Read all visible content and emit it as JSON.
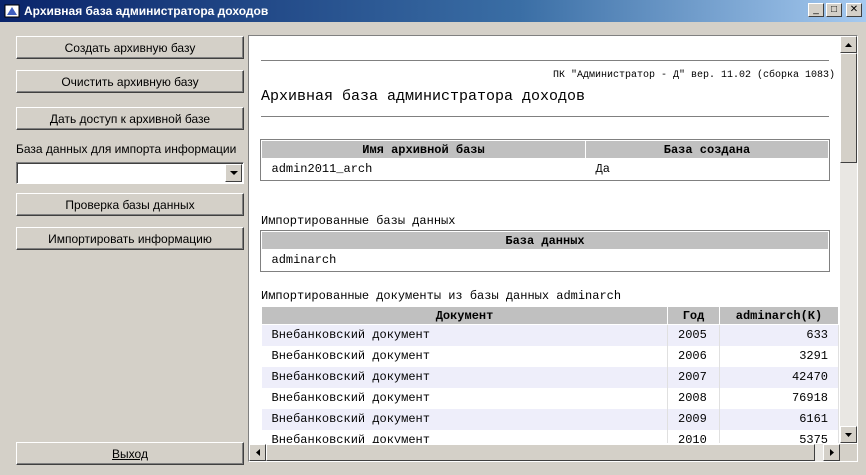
{
  "window": {
    "title": "Архивная база администратора доходов",
    "minimize_glyph": "_",
    "maximize_glyph": "□",
    "close_glyph": "✕"
  },
  "left_panel": {
    "create_button": "Создать архивную базу",
    "clear_button": "Очистить архивную базу",
    "access_button": "Дать доступ к архивной базе",
    "import_db_label": "База данных для импорта информации",
    "import_db_value": "",
    "check_button": "Проверка базы данных",
    "import_button": "Импортировать информацию",
    "exit_button": "Выход"
  },
  "report": {
    "version": "ПК \"Администратор - Д\" вер. 11.02 (сборка 1083)",
    "title": "Архивная база администратора доходов",
    "archive_table": {
      "headers": [
        "Имя архивной базы",
        "База создана"
      ],
      "row": [
        "admin2011_arch",
        "Да"
      ]
    },
    "imported_dbs_label": "Импортированные базы данных",
    "imported_dbs_table": {
      "header": "База данных",
      "row": "adminarch"
    },
    "imported_docs_label": "Импортированные документы из базы данных adminarch",
    "docs_table": {
      "headers": [
        "Документ",
        "Год",
        "adminarch(К)"
      ],
      "rows": [
        [
          "Внебанковский документ",
          "2005",
          "633"
        ],
        [
          "Внебанковский документ",
          "2006",
          "3291"
        ],
        [
          "Внебанковский документ",
          "2007",
          "42470"
        ],
        [
          "Внебанковский документ",
          "2008",
          "76918"
        ],
        [
          "Внебанковский документ",
          "2009",
          "6161"
        ],
        [
          "Внебанковский документ",
          "2010",
          "5375"
        ]
      ]
    }
  },
  "colors": {
    "titlebar": "#0a246a",
    "face": "#d4d0c8",
    "table_header": "#c0c0c0",
    "alt_row": "#eeeefa"
  }
}
